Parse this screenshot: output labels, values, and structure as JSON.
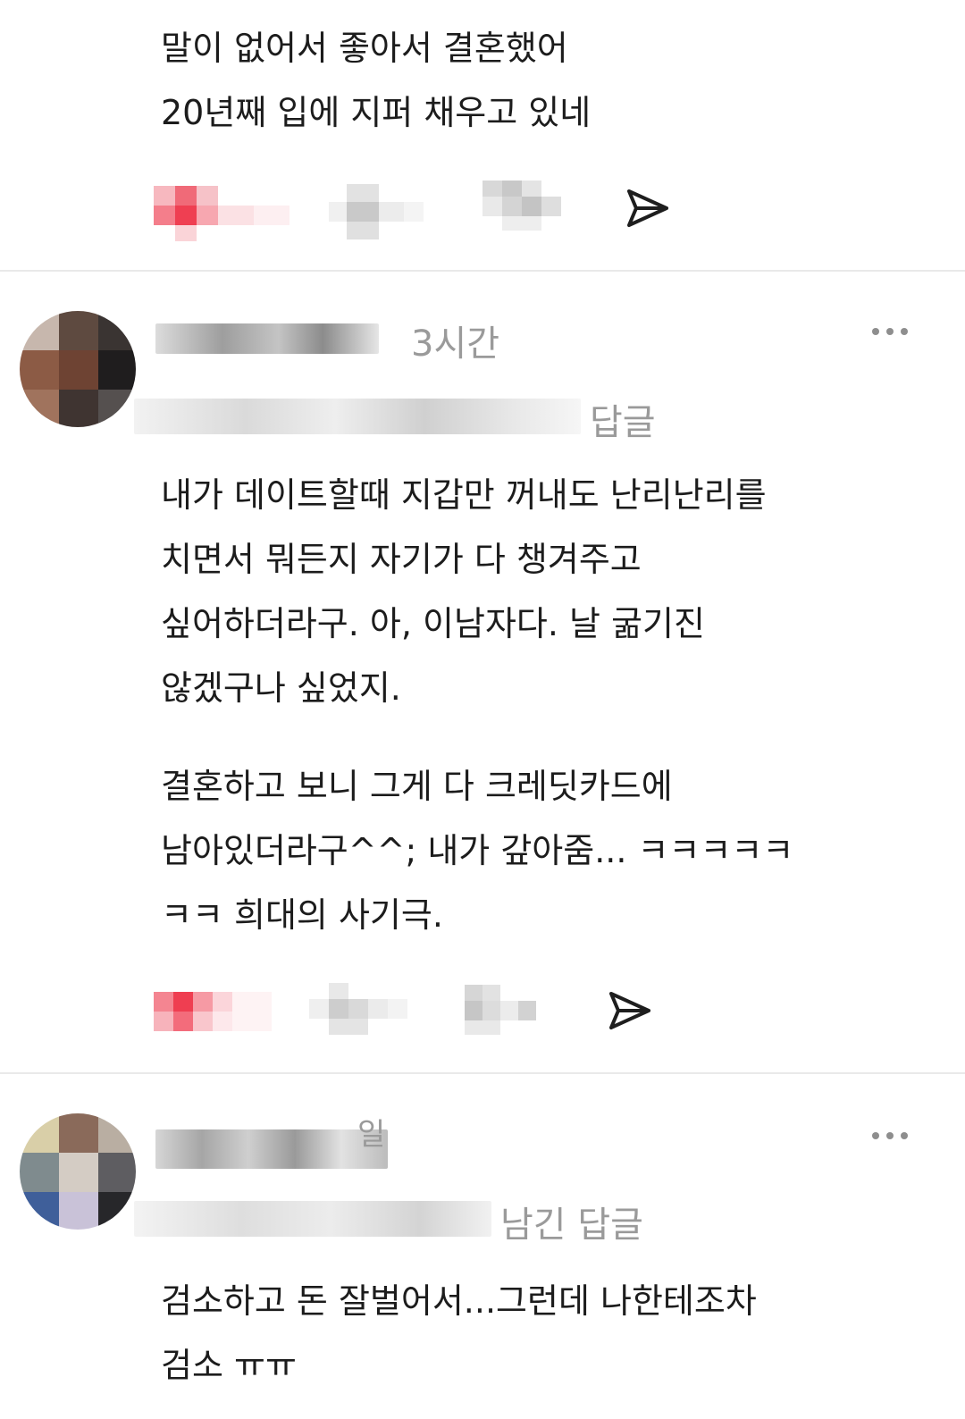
{
  "post1": {
    "body": "말이 없어서 좋아서 결혼했어\n20년째 입에 지퍼 채우고 있네"
  },
  "comment1": {
    "time_fragment": "3시간",
    "reply_label": "답글",
    "body_para1": "내가 데이트할때 지갑만 꺼내도 난리난리를\n치면서 뭐든지 자기가 다 챙겨주고\n싶어하더라구. 아, 이남자다. 날 굶기진\n않겠구나 싶었지.",
    "body_para2": "결혼하고 보니 그게 다 크레딧카드에\n남아있더라구^^; 내가 갚아줌... ㅋㅋㅋㅋㅋ\nㅋㅋ 희대의 사기극."
  },
  "comment2": {
    "time_fragment": "일",
    "reply_label": "남긴 답글",
    "body": "검소하고 돈 잘벌어서...그런데 나한테조차\n검소 ㅠㅠ"
  },
  "icons": {
    "share": "send-icon",
    "more": "more-icon",
    "like": "heart-icon",
    "comment": "comment-icon",
    "repost": "repost-icon"
  },
  "colors": {
    "like_red": "#f24f5e",
    "muted_text": "#9a9a9a",
    "divider": "#e9e9e9"
  }
}
